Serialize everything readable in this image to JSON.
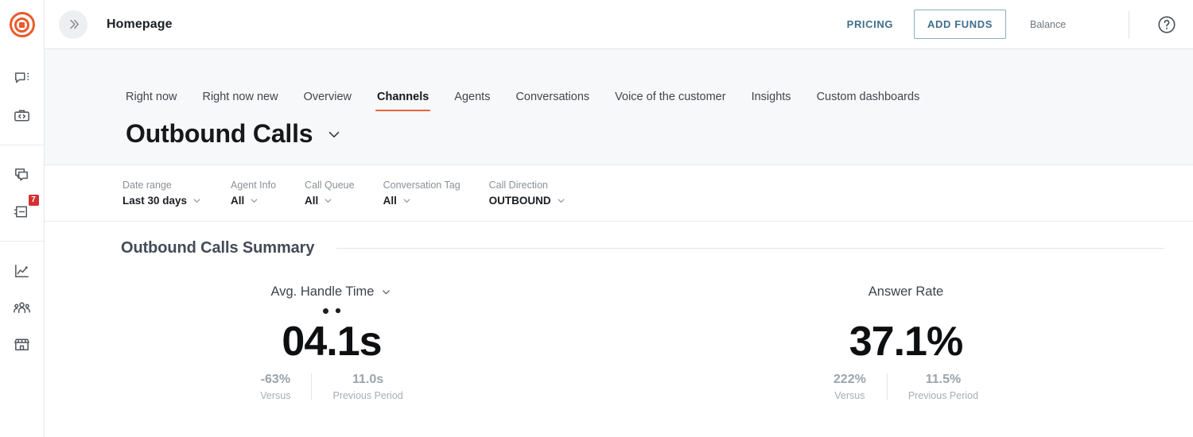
{
  "brand": {
    "accent": "#ea5b2a",
    "tab_accent": "#e8633a",
    "badge_color": "#d33030"
  },
  "rail": {
    "logo_name": "bullseye-logo",
    "items": [
      {
        "icon": "chat-bubble-menu-icon",
        "badge": ""
      },
      {
        "icon": "briefcase-code-icon",
        "badge": ""
      },
      {
        "icon": "stacked-chats-icon",
        "badge": ""
      },
      {
        "icon": "archive-chat-icon",
        "badge": "7"
      },
      {
        "icon": "line-chart-icon",
        "badge": ""
      },
      {
        "icon": "people-group-icon",
        "badge": ""
      },
      {
        "icon": "storefront-icon",
        "badge": ""
      }
    ]
  },
  "topbar": {
    "collapse_icon": "double-chevron-right-icon",
    "title": "Homepage",
    "pricing_label": "PRICING",
    "add_funds_label": "ADD FUNDS",
    "balance_label": "Balance",
    "balance_value": "",
    "help_icon": "question-circle-icon"
  },
  "tabs": [
    {
      "label": "Right now",
      "active": false
    },
    {
      "label": "Right now new",
      "active": false
    },
    {
      "label": "Overview",
      "active": false
    },
    {
      "label": "Channels",
      "active": true
    },
    {
      "label": "Agents",
      "active": false
    },
    {
      "label": "Conversations",
      "active": false
    },
    {
      "label": "Voice of the customer",
      "active": false
    },
    {
      "label": "Insights",
      "active": false
    },
    {
      "label": "Custom dashboards",
      "active": false
    }
  ],
  "dashboard": {
    "title": "Outbound Calls",
    "title_chevron": "chevron-down-icon"
  },
  "filters": [
    {
      "label": "Date range",
      "value": "Last 30 days"
    },
    {
      "label": "Agent Info",
      "value": "All"
    },
    {
      "label": "Call Queue",
      "value": "All"
    },
    {
      "label": "Conversation Tag",
      "value": "All"
    },
    {
      "label": "Call Direction",
      "value": "OUTBOUND"
    }
  ],
  "summary": {
    "heading": "Outbound Calls Summary",
    "kpis": [
      {
        "name": "Avg. Handle Time",
        "has_chevron": true,
        "has_dots": true,
        "value": "04.1s",
        "versus_value": "-63%",
        "versus_label": "Versus",
        "previous_value": "11.0s",
        "previous_label": "Previous Period"
      },
      {
        "name": "Answer Rate",
        "has_chevron": false,
        "has_dots": false,
        "value": "37.1%",
        "versus_value": "222%",
        "versus_label": "Versus",
        "previous_value": "11.5%",
        "previous_label": "Previous Period"
      }
    ]
  }
}
